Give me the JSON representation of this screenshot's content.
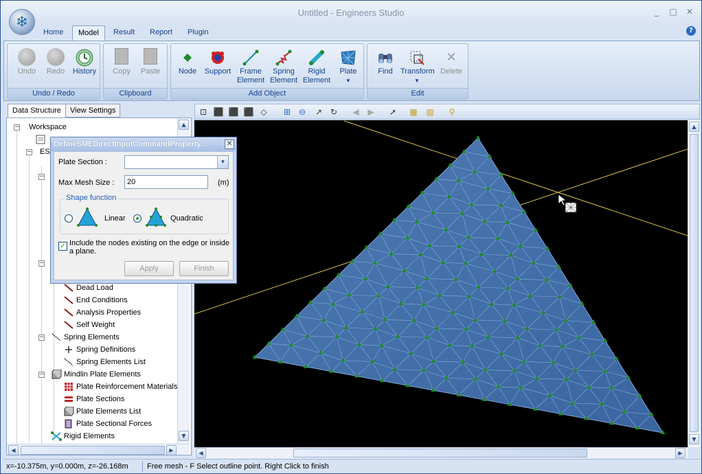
{
  "window": {
    "title": "Untitled - Engineers Studio",
    "minimize": "_",
    "maximize": "□",
    "close": "✕"
  },
  "ribbon_tabs": [
    "Home",
    "Model",
    "Result",
    "Report",
    "Plugin"
  ],
  "active_tab": "Model",
  "help": "?",
  "ribbon_groups": {
    "undo_redo": {
      "label": "Undo / Redo",
      "undo": "Undo",
      "redo": "Redo",
      "history": "History"
    },
    "clipboard": {
      "label": "Clipboard",
      "copy": "Copy",
      "paste": "Paste"
    },
    "add_object": {
      "label": "Add Object",
      "node": "Node",
      "support": "Support",
      "frame_element_1": "Frame",
      "frame_element_2": "Element",
      "spring_element_1": "Spring",
      "spring_element_2": "Element",
      "rigid_element_1": "Rigid",
      "rigid_element_2": "Element",
      "plate": "Plate"
    },
    "edit": {
      "label": "Edit",
      "find": "Find",
      "transform": "Transform",
      "delete": "Delete"
    }
  },
  "left_panel": {
    "tabs": [
      "Data Structure",
      "View Settings"
    ],
    "tree": {
      "workspace": "Workspace",
      "es_prefix": "ES",
      "items": [
        "Dead Load",
        "End Conditions",
        "Analysis Properties",
        "Self Weight",
        "Spring Elements",
        "Spring Definitions",
        "Spring Elements List",
        "Mindlin Plate Elements",
        "Plate Reinforcement Materials",
        "Plate Sections",
        "Plate Elements List",
        "Plate Sectional Forces",
        "Rigid Elements"
      ]
    }
  },
  "dialog": {
    "title": "DefineSMEDirectInputCommandProperty...",
    "plate_section_label": "Plate Section :",
    "plate_section_value": "",
    "max_mesh_label": "Max Mesh Size :",
    "max_mesh_value": "20",
    "max_mesh_unit": "(m)",
    "shape_function_legend": "Shape function",
    "linear_label": "Linear",
    "quadratic_label": "Quadratic",
    "shape_selected": "Quadratic",
    "include_nodes_checked": true,
    "include_nodes_label_1": "Include the nodes existing on the edge or inside",
    "include_nodes_label_2": "a plane.",
    "apply": "Apply",
    "finish": "Finish"
  },
  "status_bar": {
    "coords": "x=-10.375m, y=0.000m, z=-26.168m",
    "message": "Free mesh - F Select outline point. Right Click to finish"
  },
  "colors": {
    "ribbon_text": "#15428b",
    "plate_fill": "#3f6ea8",
    "node_green": "#1f8a2a",
    "axis_line": "#d7c64a"
  }
}
